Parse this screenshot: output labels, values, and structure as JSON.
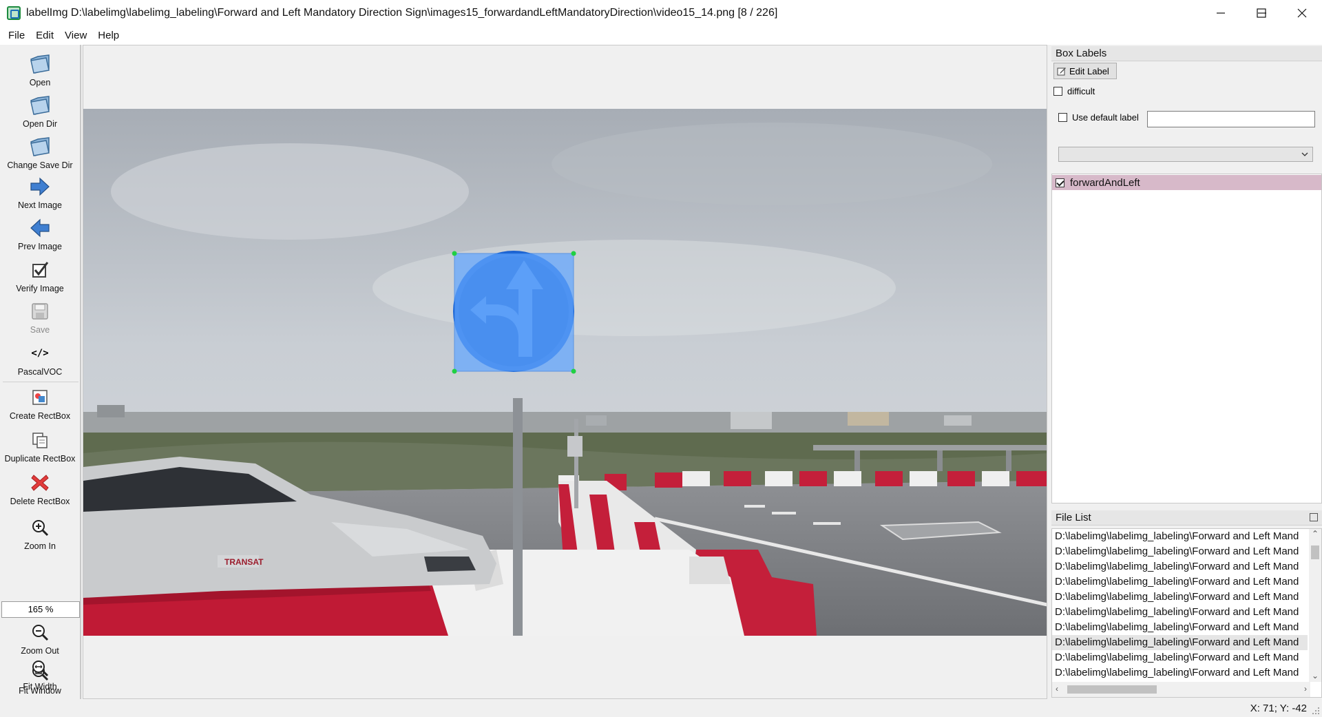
{
  "window": {
    "title": "labelImg D:\\labelimg\\labelimg_labeling\\Forward and Left Mandatory Direction Sign\\images15_forwardandLeftMandatoryDirection\\video15_14.png [8 / 226]"
  },
  "menu": [
    "File",
    "Edit",
    "View",
    "Help"
  ],
  "toolbar": {
    "open": "Open",
    "open_dir": "Open Dir",
    "change_save_dir": "Change Save Dir",
    "next_image": "Next Image",
    "prev_image": "Prev Image",
    "verify_image": "Verify Image",
    "save": "Save",
    "format": "PascalVOC",
    "format_icon": "</>",
    "create_rectbox": "Create RectBox",
    "duplicate_rectbox": "Duplicate RectBox",
    "delete_rectbox": "Delete RectBox",
    "zoom_in": "Zoom In",
    "zoom_value": "165 %",
    "zoom_out": "Zoom Out",
    "fit_window": "Fit Window",
    "fit_width": "Fit Width"
  },
  "box_labels": {
    "title": "Box Labels",
    "edit_label": "Edit Label",
    "difficult": "difficult",
    "difficult_checked": false,
    "use_default_label": "Use default label",
    "use_default_checked": false,
    "default_label_value": "",
    "labels": [
      {
        "name": "forwardAndLeft",
        "checked": true,
        "color": "#d7b9c9"
      }
    ]
  },
  "file_list": {
    "title": "File List",
    "selected_index": 7,
    "items": [
      "D:\\labelimg\\labelimg_labeling\\Forward and Left Mand",
      "D:\\labelimg\\labelimg_labeling\\Forward and Left Mand",
      "D:\\labelimg\\labelimg_labeling\\Forward and Left Mand",
      "D:\\labelimg\\labelimg_labeling\\Forward and Left Mand",
      "D:\\labelimg\\labelimg_labeling\\Forward and Left Mand",
      "D:\\labelimg\\labelimg_labeling\\Forward and Left Mand",
      "D:\\labelimg\\labelimg_labeling\\Forward and Left Mand",
      "D:\\labelimg\\labelimg_labeling\\Forward and Left Mand",
      "D:\\labelimg\\labelimg_labeling\\Forward and Left Mand",
      "D:\\labelimg\\labelimg_labeling\\Forward and Left Mand"
    ]
  },
  "status": {
    "coords": "X: 71; Y: -42"
  },
  "colors": {
    "bbox_fill": "#5aa0f5",
    "bbox_corner": "#22c55e",
    "sign_blue": "#0a63d6"
  }
}
